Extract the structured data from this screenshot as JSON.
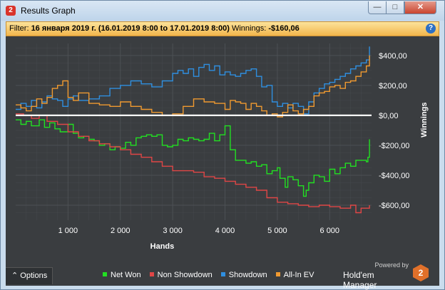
{
  "window": {
    "title": "Results Graph",
    "icon": "hm2-icon",
    "controls": {
      "minimize": "—",
      "maximize": "□",
      "close": "✕"
    }
  },
  "filter": {
    "label": "Filter:",
    "value": "16 января 2019 г. (16.01.2019 8:00 to 17.01.2019 8:00)",
    "winnings_label": "Winnings:",
    "winnings_value": "-$160,06"
  },
  "options_label": "Options",
  "options_icon": "chevron-up-icon",
  "branding": {
    "powered": "Powered by",
    "name": "Hold'em Manager",
    "logo": "2"
  },
  "colors": {
    "background": "#3a3d40",
    "grid": "#4c5054",
    "zero_line": "#ffffff"
  },
  "chart_data": {
    "type": "line",
    "xlabel": "Hands",
    "ylabel": "Winnings",
    "xlim": [
      0,
      6800
    ],
    "ylim": [
      -700,
      480
    ],
    "xticks": [
      1000,
      2000,
      3000,
      4000,
      5000,
      6000
    ],
    "xtick_labels": [
      "1 000",
      "2 000",
      "3 000",
      "4 000",
      "5 000",
      "6 000"
    ],
    "yticks": [
      400,
      200,
      0,
      -200,
      -400,
      -600
    ],
    "ytick_labels": [
      "$400,00",
      "$200,00",
      "$0,00",
      "-$200,00",
      "-$400,00",
      "-$600,00"
    ],
    "grid": true,
    "legend_position": "bottom",
    "series": [
      {
        "name": "Net Won",
        "color": "#22e022",
        "x": [
          0,
          100,
          200,
          300,
          450,
          550,
          650,
          750,
          850,
          1000,
          1100,
          1200,
          1300,
          1400,
          1500,
          1600,
          1700,
          1800,
          1900,
          2000,
          2100,
          2200,
          2300,
          2400,
          2500,
          2600,
          2700,
          2800,
          2900,
          3000,
          3100,
          3200,
          3300,
          3400,
          3500,
          3600,
          3700,
          3800,
          3900,
          4000,
          4100,
          4200,
          4300,
          4400,
          4500,
          4600,
          4700,
          4800,
          4900,
          5000,
          5050,
          5150,
          5200,
          5300,
          5400,
          5500,
          5550,
          5600,
          5700,
          5800,
          5900,
          6000,
          6100,
          6200,
          6300,
          6400,
          6500,
          6600,
          6700,
          6730,
          6760
        ],
        "y": [
          -30,
          -60,
          -40,
          -70,
          -30,
          -80,
          -50,
          -90,
          -110,
          -60,
          -120,
          -150,
          -140,
          -160,
          -170,
          -200,
          -190,
          -230,
          -210,
          -220,
          -180,
          -200,
          -150,
          -140,
          -130,
          -140,
          -130,
          -200,
          -210,
          -200,
          -160,
          -170,
          -150,
          -160,
          -170,
          -160,
          -120,
          -170,
          -130,
          -70,
          -230,
          -300,
          -300,
          -320,
          -310,
          -340,
          -330,
          -390,
          -370,
          -350,
          -420,
          -480,
          -410,
          -430,
          -470,
          -540,
          -500,
          -450,
          -400,
          -410,
          -440,
          -360,
          -390,
          -350,
          -320,
          -340,
          -300,
          -300,
          -310,
          -280,
          -160
        ]
      },
      {
        "name": "Non Showdown",
        "color": "#e04646",
        "x": [
          0,
          150,
          300,
          450,
          600,
          800,
          1000,
          1200,
          1400,
          1600,
          1800,
          2000,
          2200,
          2400,
          2600,
          2800,
          3000,
          3200,
          3400,
          3600,
          3800,
          4000,
          4200,
          4400,
          4600,
          4800,
          5000,
          5200,
          5400,
          5600,
          5800,
          6000,
          6200,
          6400,
          6500,
          6600,
          6760
        ],
        "y": [
          10,
          0,
          -20,
          0,
          -40,
          -60,
          -110,
          -140,
          -170,
          -190,
          -210,
          -230,
          -260,
          -280,
          -310,
          -340,
          -370,
          -370,
          -380,
          -410,
          -420,
          -440,
          -460,
          -480,
          -500,
          -550,
          -580,
          -590,
          -600,
          -610,
          -600,
          -610,
          -620,
          -600,
          -650,
          -620,
          -600
        ]
      },
      {
        "name": "Showdown",
        "color": "#2f8fe0",
        "x": [
          0,
          100,
          200,
          300,
          400,
          500,
          600,
          700,
          800,
          900,
          1000,
          1100,
          1200,
          1400,
          1600,
          1800,
          2000,
          2200,
          2400,
          2600,
          2800,
          3000,
          3100,
          3200,
          3300,
          3400,
          3500,
          3600,
          3700,
          3800,
          3900,
          4000,
          4100,
          4200,
          4300,
          4400,
          4500,
          4600,
          4700,
          4800,
          4900,
          5000,
          5100,
          5200,
          5300,
          5400,
          5500,
          5600,
          5700,
          5800,
          5900,
          6000,
          6100,
          6200,
          6300,
          6400,
          6500,
          6600,
          6700,
          6760
        ],
        "y": [
          40,
          80,
          60,
          100,
          50,
          90,
          130,
          110,
          100,
          60,
          110,
          130,
          100,
          110,
          130,
          180,
          200,
          230,
          210,
          190,
          230,
          280,
          300,
          280,
          310,
          260,
          320,
          340,
          300,
          330,
          270,
          290,
          270,
          260,
          280,
          300,
          310,
          260,
          190,
          200,
          90,
          60,
          80,
          50,
          80,
          60,
          10,
          90,
          150,
          180,
          210,
          220,
          240,
          260,
          280,
          310,
          330,
          350,
          370,
          460
        ]
      },
      {
        "name": "All-In EV",
        "color": "#f09a30",
        "x": [
          0,
          100,
          200,
          300,
          400,
          500,
          600,
          700,
          800,
          900,
          1000,
          1100,
          1200,
          1400,
          1600,
          1800,
          2000,
          2200,
          2400,
          2600,
          2800,
          3000,
          3200,
          3400,
          3600,
          3800,
          4000,
          4100,
          4200,
          4300,
          4400,
          4500,
          4600,
          4700,
          4800,
          4900,
          5000,
          5100,
          5200,
          5300,
          5400,
          5500,
          5600,
          5700,
          5800,
          5900,
          6000,
          6100,
          6200,
          6300,
          6400,
          6500,
          6600,
          6700,
          6760
        ],
        "y": [
          70,
          50,
          30,
          60,
          110,
          80,
          120,
          180,
          200,
          230,
          120,
          100,
          150,
          80,
          70,
          60,
          90,
          60,
          40,
          20,
          0,
          10,
          60,
          110,
          90,
          80,
          40,
          100,
          90,
          80,
          40,
          80,
          60,
          30,
          0,
          10,
          -10,
          20,
          70,
          30,
          10,
          40,
          60,
          130,
          150,
          160,
          190,
          200,
          180,
          220,
          230,
          260,
          290,
          330,
          400
        ]
      }
    ]
  }
}
